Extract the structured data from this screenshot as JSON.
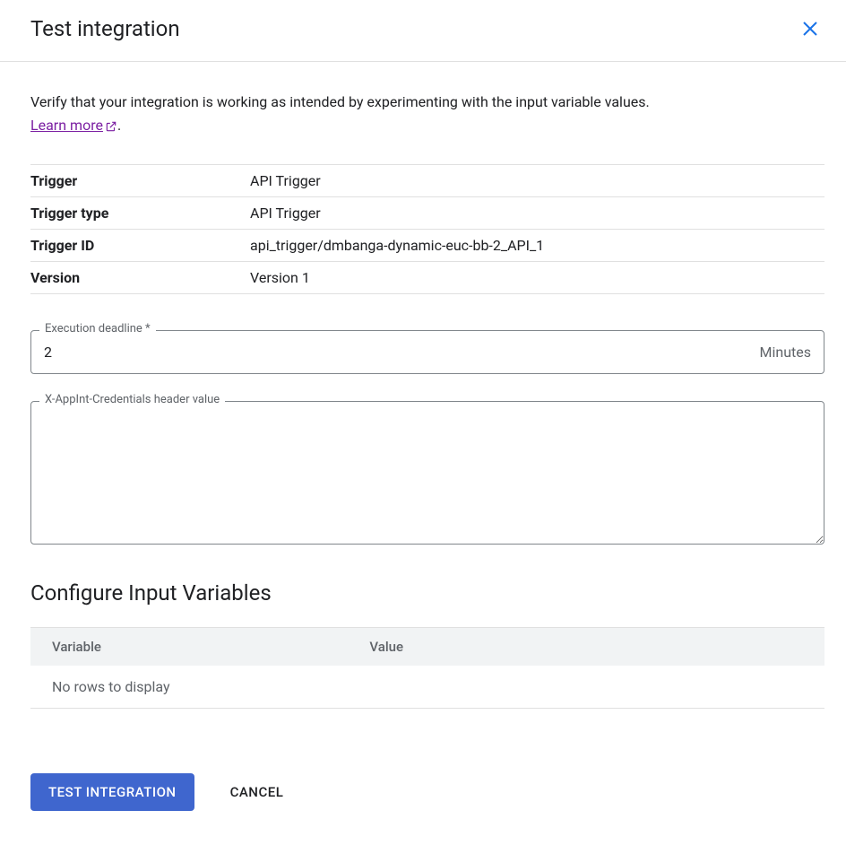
{
  "header": {
    "title": "Test integration"
  },
  "description": {
    "text": "Verify that your integration is working as intended by experimenting with the input variable values. ",
    "learn_more": "Learn more",
    "period": "."
  },
  "info": {
    "rows": [
      {
        "label": "Trigger",
        "value": "API Trigger"
      },
      {
        "label": "Trigger type",
        "value": "API Trigger"
      },
      {
        "label": "Trigger ID",
        "value": "api_trigger/dmbanga-dynamic-euc-bb-2_API_1"
      },
      {
        "label": "Version",
        "value": "Version 1"
      }
    ]
  },
  "fields": {
    "deadline": {
      "label": "Execution deadline *",
      "value": "2",
      "suffix": "Minutes"
    },
    "credentials": {
      "label": "X-AppInt-Credentials header value",
      "value": ""
    }
  },
  "input_vars": {
    "title": "Configure Input Variables",
    "columns": {
      "variable": "Variable",
      "value": "Value"
    },
    "empty": "No rows to display"
  },
  "buttons": {
    "test": "TEST INTEGRATION",
    "cancel": "CANCEL"
  }
}
